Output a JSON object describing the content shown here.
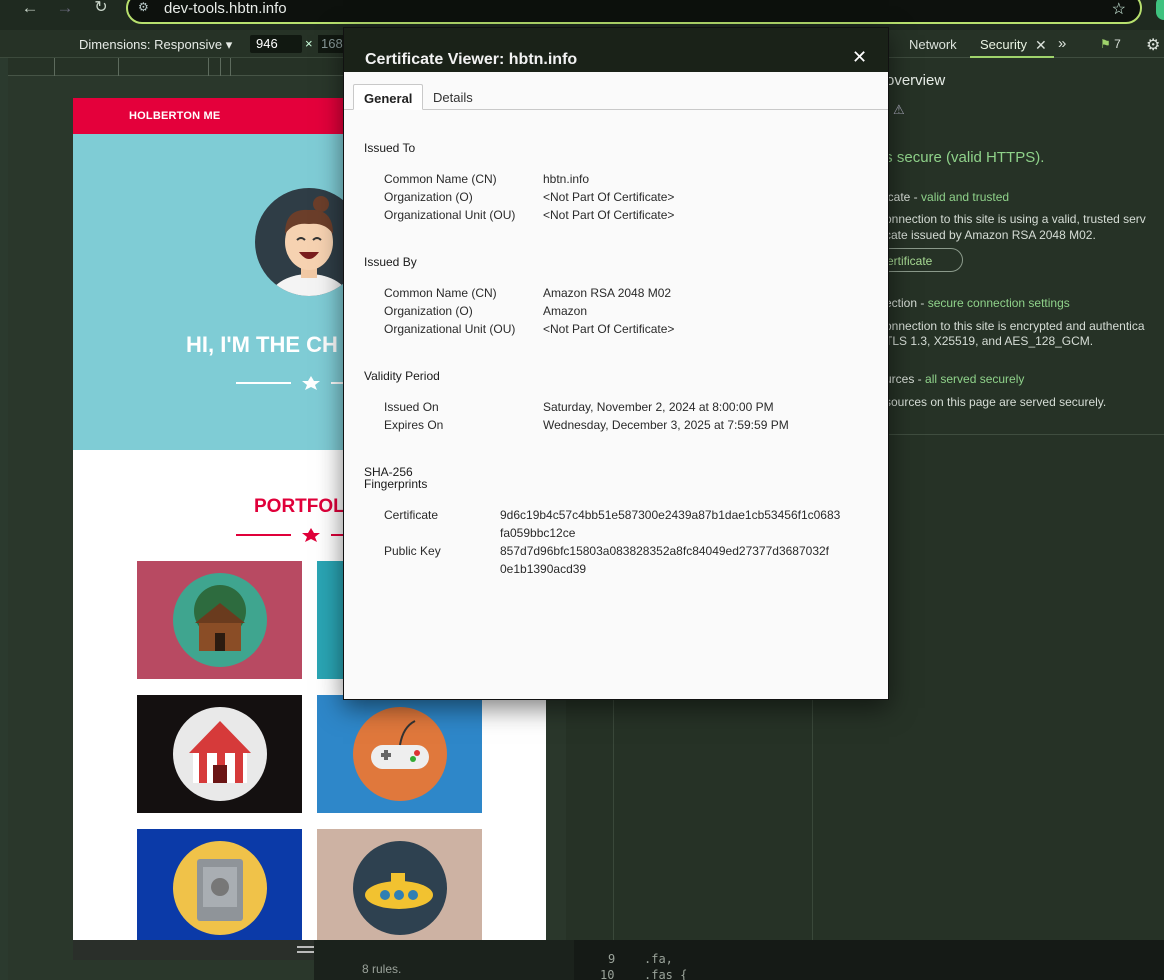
{
  "browser": {
    "url": "dev-tools.hbtn.info"
  },
  "device_toolbar": {
    "dimensions_label": "Dimensions: Responsive",
    "width_value": "946",
    "separator": "×",
    "height_value": "168"
  },
  "site": {
    "brand": "HOLBERTON ME",
    "hero_title": "HI, I'M THE CH",
    "portfolio_title": "PORTFOL"
  },
  "devtools": {
    "tabs": {
      "network": "Network",
      "security": "Security",
      "more": "»",
      "issues_count": "7"
    },
    "security": {
      "overview": "overview",
      "secure_headline": "ge is secure (valid HTTPS).",
      "certificate_label": "icate - ",
      "certificate_status": "valid and trusted",
      "certificate_desc_1": "onnection to this site is using a valid, trusted serv",
      "certificate_desc_2": "cate issued by Amazon RSA 2048 M02.",
      "view_certificate": "w certificate",
      "connection_label": "ection - ",
      "connection_status": "secure connection settings",
      "connection_desc_1": "onnection to this site is encrypted and authentica",
      "connection_desc_2": "TLS 1.3, X25519, and AES_128_GCM.",
      "resources_label": "urces - ",
      "resources_status": "all served securely",
      "resources_desc": "sources on this page are served securely."
    },
    "styles_rules": "8 rules.",
    "code_lines": [
      {
        "line_no": "9",
        "text": ".fa,"
      },
      {
        "line_no": "10",
        "text": ".fas {"
      }
    ]
  },
  "dialog": {
    "title": "Certificate Viewer: hbtn.info",
    "tabs": {
      "general": "General",
      "details": "Details"
    },
    "issued_to": {
      "heading": "Issued To",
      "cn_label": "Common Name (CN)",
      "cn_value": "hbtn.info",
      "o_label": "Organization (O)",
      "o_value": "<Not Part Of Certificate>",
      "ou_label": "Organizational Unit (OU)",
      "ou_value": "<Not Part Of Certificate>"
    },
    "issued_by": {
      "heading": "Issued By",
      "cn_label": "Common Name (CN)",
      "cn_value": "Amazon RSA 2048 M02",
      "o_label": "Organization (O)",
      "o_value": "Amazon",
      "ou_label": "Organizational Unit (OU)",
      "ou_value": "<Not Part Of Certificate>"
    },
    "validity": {
      "heading": "Validity Period",
      "issued_label": "Issued On",
      "issued_value": "Saturday, November 2, 2024 at 8:00:00 PM",
      "expires_label": "Expires On",
      "expires_value": "Wednesday, December 3, 2025 at 7:59:59 PM"
    },
    "fingerprints": {
      "heading_1": "SHA-256",
      "heading_2": "Fingerprints",
      "cert_label": "Certificate",
      "cert_value_1": "9d6c19b4c57c4bb51e587300e2439a87b1dae1cb53456f1c0683",
      "cert_value_2": "fa059bbc12ce",
      "pk_label": "Public Key",
      "pk_value_1": "857d7d96bfc15803a083828352a8fc84049ed27377d3687032f",
      "pk_value_2": "0e1b1390acd39"
    }
  },
  "colors": {
    "accent": "#e4003b",
    "hero_bg": "#7fccd5",
    "secure_green": "#8fd28a",
    "url_border": "#b7e06e"
  }
}
